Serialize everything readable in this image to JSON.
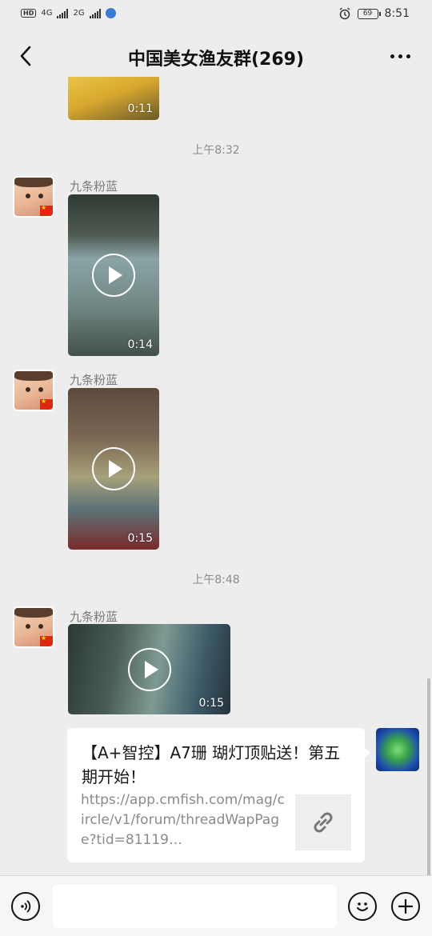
{
  "status_bar": {
    "left_badges": [
      "HD",
      "4G",
      "2G"
    ],
    "battery": "69",
    "time": "8:51"
  },
  "nav": {
    "title": "中国美女渔友群(269)",
    "back_icon": "chevron-left-icon",
    "more_icon": "more-dots-icon"
  },
  "messages": {
    "top_video": {
      "duration": "0:11"
    },
    "time_1": "上午8:32",
    "video_1": {
      "sender": "九条粉蓝",
      "duration": "0:14"
    },
    "video_2": {
      "sender": "九条粉蓝",
      "duration": "0:15"
    },
    "time_2": "上午8:48",
    "video_3": {
      "sender": "九条粉蓝",
      "duration": "0:15"
    },
    "link_card": {
      "title": "【A+智控】A7珊 瑚灯顶贴送！第五期开始！",
      "url": "https://app.cmfish.com/mag/circle/v1/forum/threadWapPage?tid=81119…",
      "icon": "link-icon"
    }
  },
  "input_bar": {
    "voice_icon": "voice-icon",
    "emoji_icon": "emoji-icon",
    "plus_icon": "plus-icon",
    "input_value": ""
  },
  "colors": {
    "background": "#ededed",
    "bubble": "#ffffff",
    "meta_text": "#8c8c8c"
  }
}
